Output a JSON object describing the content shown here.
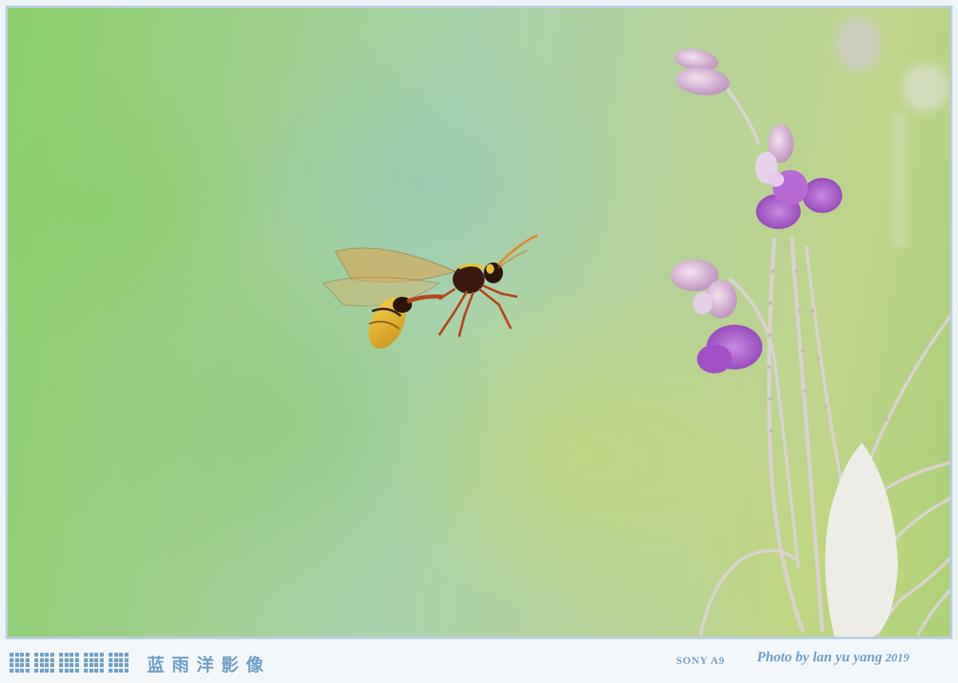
{
  "photo": {
    "subject": "wasp-in-flight",
    "secondary_subject": "purple-flowers"
  },
  "footer": {
    "brand": "蓝雨洋影像",
    "camera": "SONY A9",
    "credit": "Photo by lan yu yang",
    "year": "2019",
    "dot_clusters": 5
  },
  "colors": {
    "frame_border": "#b9cfe2",
    "footer_text": "#6f9fc7",
    "background_green": "#9fd08c"
  }
}
